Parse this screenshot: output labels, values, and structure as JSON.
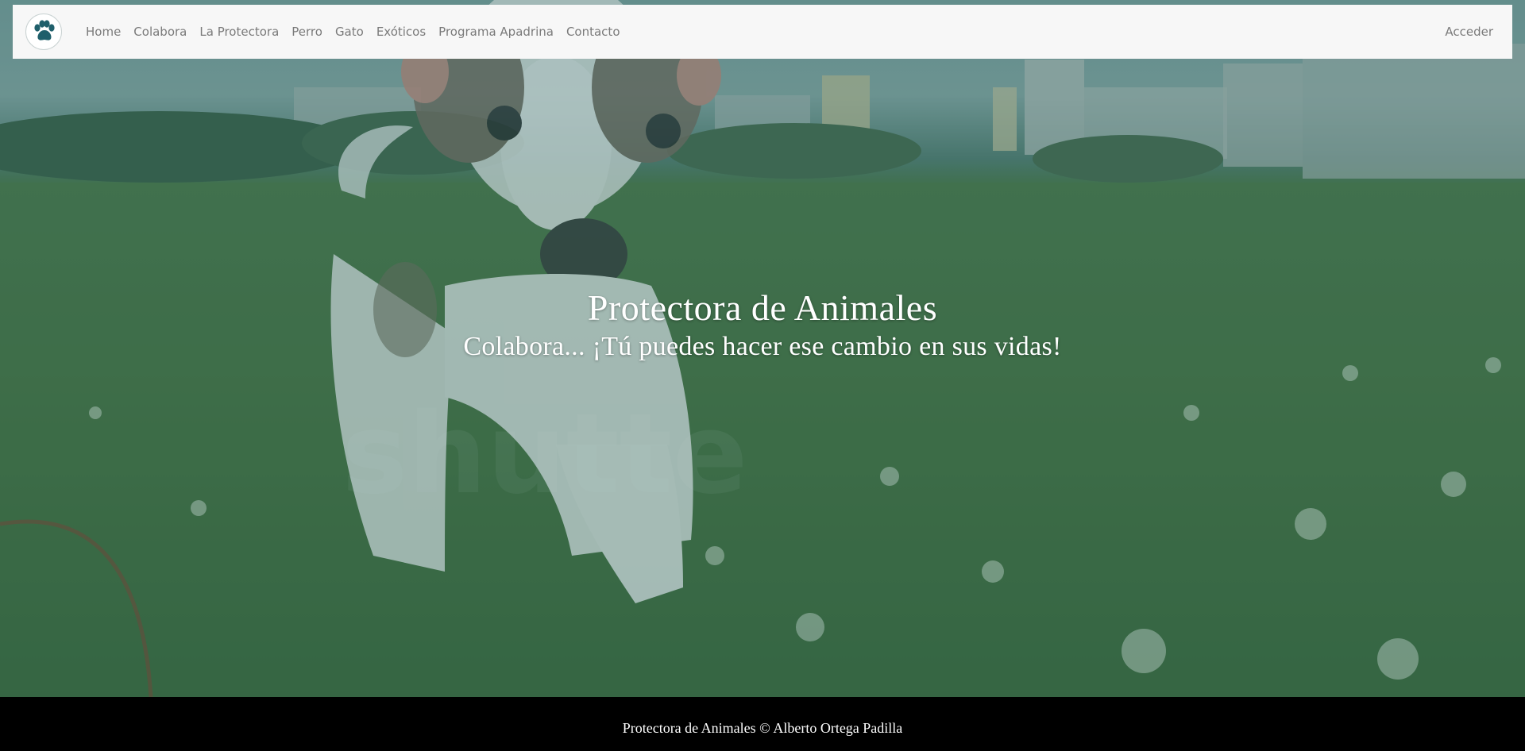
{
  "nav": {
    "logo_icon": "paw-print-icon",
    "links": [
      {
        "label": "Home"
      },
      {
        "label": "Colabora"
      },
      {
        "label": "La Protectora"
      },
      {
        "label": "Perro"
      },
      {
        "label": "Gato"
      },
      {
        "label": "Exóticos"
      },
      {
        "label": "Programa Apadrina"
      },
      {
        "label": "Contacto"
      }
    ],
    "login_label": "Acceder"
  },
  "hero": {
    "title": "Protectora de Animales",
    "subtitle": "Colabora... ¡Tú puedes hacer ese cambio en sus vidas!"
  },
  "footer": {
    "text": "Protectora de Animales © Alberto Ortega Padilla"
  },
  "colors": {
    "navbar_bg": "#f7f7f7",
    "logo_accent": "#1f5f6b",
    "footer_bg": "#000000",
    "overlay_tint": "#1e5a5a"
  }
}
